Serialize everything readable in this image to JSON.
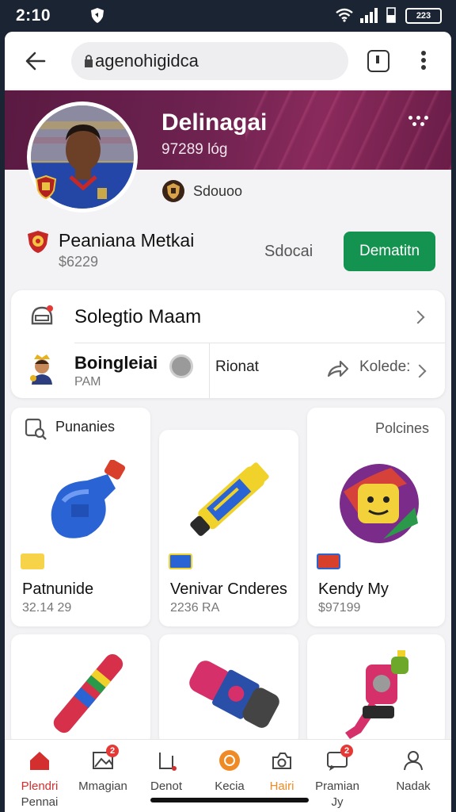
{
  "status": {
    "time": "2:10",
    "battery": "223"
  },
  "browser": {
    "url": "agenohigidca"
  },
  "profile": {
    "name": "Delinagai",
    "subtitle": "97289 lóg",
    "club": "Sdouoo"
  },
  "channel": {
    "name": "Peaniana Metkai",
    "count": "$6229",
    "link_label": "Sdocai",
    "button_label": "Dematitn"
  },
  "info_card": {
    "top_label": "Solegtio Maam",
    "person_name": "Boingleiai",
    "person_sub": "PAM",
    "middle_label": "Rionat",
    "right_label": "Kolede:"
  },
  "sections": {
    "left_label": "Punanies",
    "right_label": "Polcines"
  },
  "products": [
    {
      "title": "Patnunide",
      "price": "32.14 29",
      "icon": "water-bottle-icon"
    },
    {
      "title": "Venivar Cnderes",
      "price": "2236 RA",
      "icon": "flashlight-icon"
    },
    {
      "title": "Kendy My",
      "price": "$97199",
      "icon": "ball-icon"
    },
    {
      "title": "",
      "price": "",
      "icon": "bat-icon"
    },
    {
      "title": "",
      "price": "",
      "icon": "roller-icon"
    },
    {
      "title": "",
      "price": "",
      "icon": "robot-icon"
    }
  ],
  "nav": [
    {
      "label": "Plendri",
      "label2": "Pennai",
      "icon": "home-icon",
      "badge": ""
    },
    {
      "label": "Mmagian",
      "label2": "",
      "icon": "image-icon",
      "badge": "2"
    },
    {
      "label": "Denot",
      "label2": "",
      "icon": "frame-icon",
      "badge": ""
    },
    {
      "label": "Kecia",
      "label2": "",
      "icon": "circle-icon",
      "badge": ""
    },
    {
      "label": "Hairi",
      "label2": "",
      "icon": "camera-icon",
      "badge": ""
    },
    {
      "label": "Pramian",
      "label2": "Jy",
      "icon": "chat-icon",
      "badge": "2"
    },
    {
      "label": "Nadak",
      "label2": "",
      "icon": "user-icon",
      "badge": ""
    }
  ],
  "colors": {
    "accent_green": "#14924f",
    "hero_purple": "#6e2250",
    "nav_active_red": "#d32f2f",
    "nav_orange": "#f08a24"
  }
}
